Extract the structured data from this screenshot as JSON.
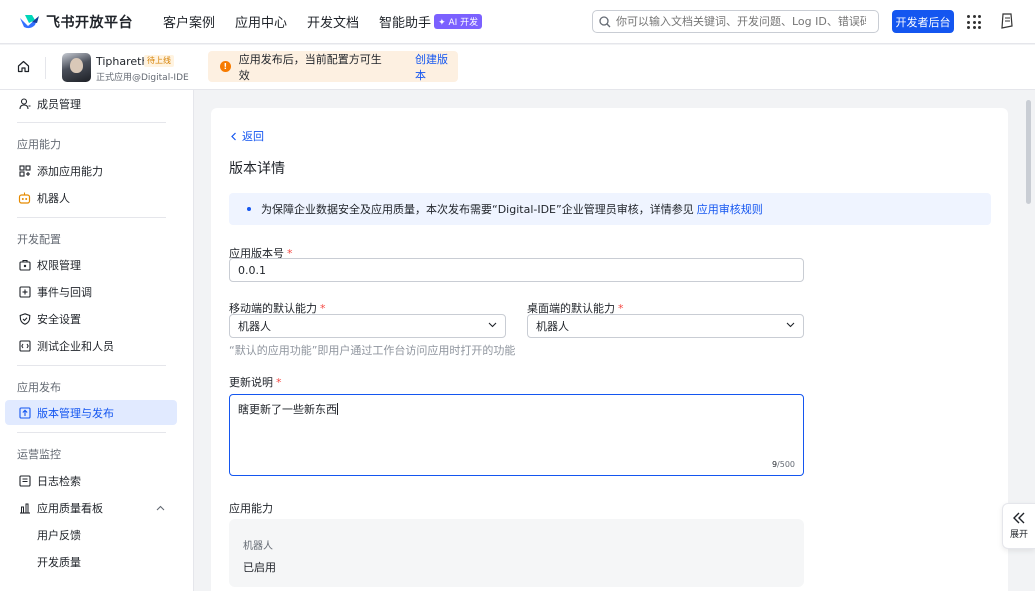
{
  "brand": {
    "name": "飞书开放平台"
  },
  "nav": {
    "items": [
      "客户案例",
      "应用中心",
      "开发文档",
      "智能助手"
    ],
    "ai_badge": "✦ AI 开发"
  },
  "search": {
    "placeholder": "你可以输入文档关键词、开发问题、Log ID、错误码"
  },
  "dev_button": "开发者后台",
  "app": {
    "name": "Tiphareth",
    "status": "待上线",
    "subtitle": "正式应用@Digital-IDE"
  },
  "notice": {
    "text": "应用发布后，当前配置方可生效",
    "link": "创建版本"
  },
  "sidebar": {
    "top_item": "成员管理",
    "sections": [
      {
        "title": "应用能力",
        "items": [
          "添加应用能力",
          "机器人"
        ]
      },
      {
        "title": "开发配置",
        "items": [
          "权限管理",
          "事件与回调",
          "安全设置",
          "测试企业和人员"
        ]
      },
      {
        "title": "应用发布",
        "items": [
          "版本管理与发布"
        ]
      },
      {
        "title": "运营监控",
        "items": [
          "日志检索",
          "应用质量看板"
        ]
      }
    ],
    "sub_items": [
      "用户反馈",
      "开发质量"
    ]
  },
  "detail": {
    "back": "返回",
    "title": "版本详情",
    "info_text": "为保障企业数据安全及应用质量，本次发布需要“Digital-IDE”企业管理员审核，详情参见",
    "info_link": "应用审核规则",
    "version_label": "应用版本号",
    "version_value": "0.0.1",
    "mobile_label": "移动端的默认能力",
    "mobile_value": "机器人",
    "desktop_label": "桌面端的默认能力",
    "desktop_value": "机器人",
    "hint": "“默认的应用功能”即用户通过工作台访问应用时打开的功能",
    "notes_label": "更新说明",
    "notes_value": "瞎更新了一些新东西",
    "notes_count": "9",
    "notes_max": "/500",
    "capability_label": "应用能力",
    "capability_name": "机器人",
    "capability_state": "已启用"
  },
  "expand_label": "展开",
  "colors": {
    "primary": "#1456f0",
    "warning": "#f77b00",
    "required": "#f54a45"
  }
}
